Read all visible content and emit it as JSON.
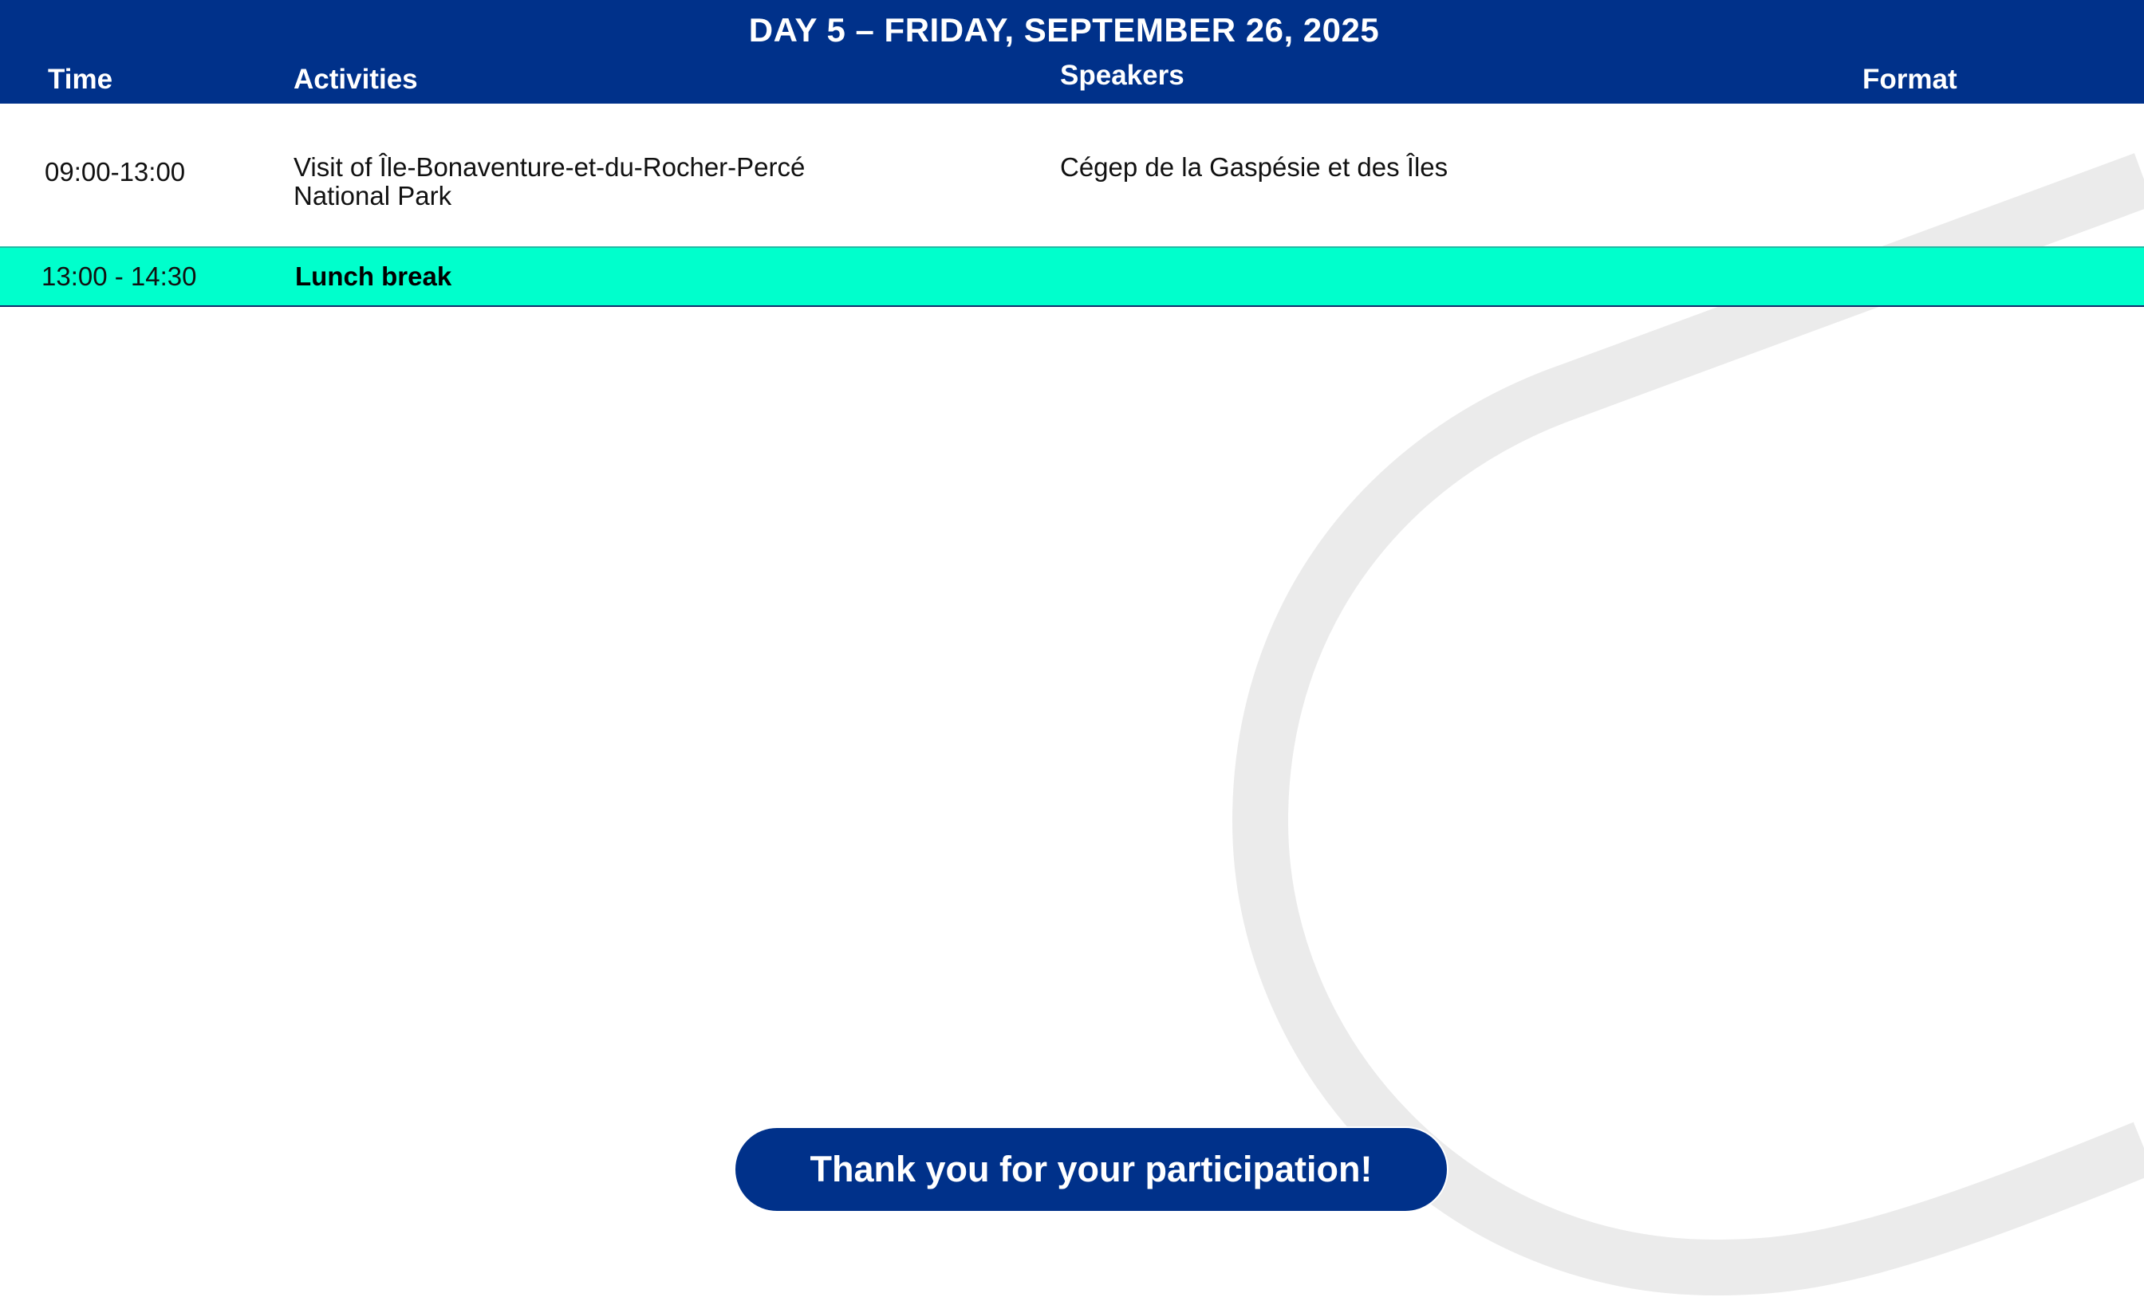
{
  "header": {
    "title": "DAY 5 – FRIDAY, SEPTEMBER 26, 2025",
    "columns": {
      "time": "Time",
      "activities": "Activities",
      "speakers": "Speakers",
      "format": "Format"
    }
  },
  "rows": [
    {
      "time": "09:00-13:00",
      "activity_line1": "Visit of Île-Bonaventure-et-du-Rocher-Percé",
      "activity_line2": "National Park",
      "speaker": "Cégep de la Gaspésie et des Îles",
      "format": ""
    },
    {
      "time": "13:00 - 14:30",
      "activity": "Lunch break"
    }
  ],
  "footer": {
    "message": "Thank you for your participation!"
  },
  "colors": {
    "brand_blue": "#00318a",
    "accent_teal": "#00ffcc",
    "decor_gray": "#ebebeb"
  }
}
